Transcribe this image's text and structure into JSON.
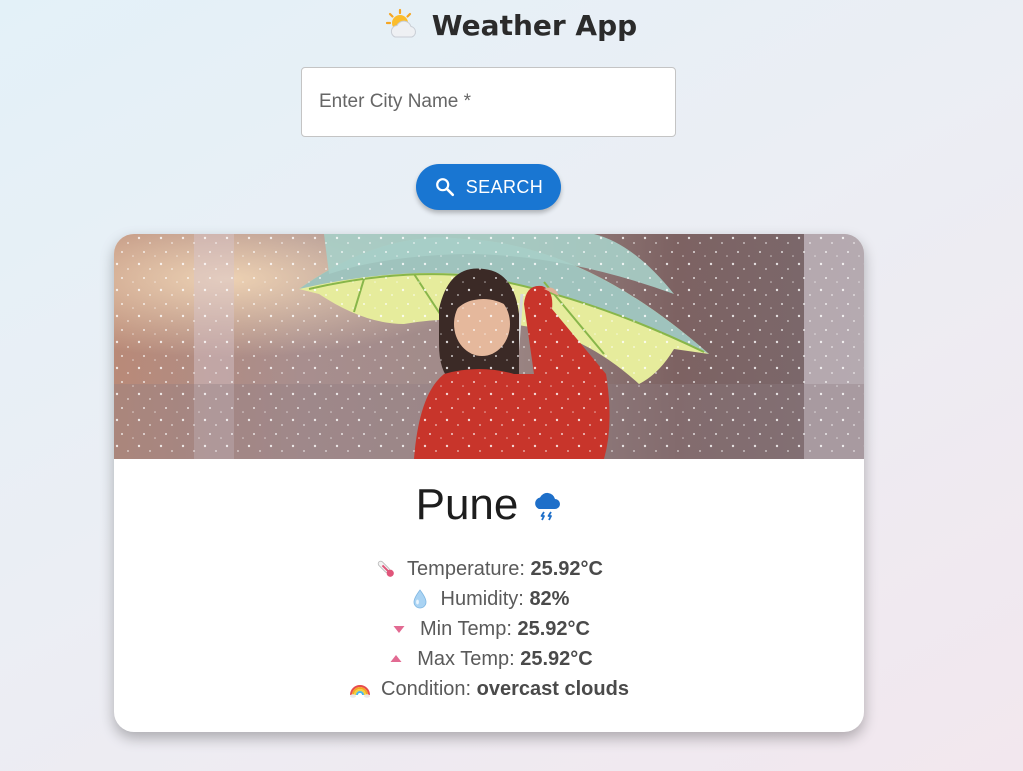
{
  "app": {
    "title": "Weather App",
    "logo_icon": "sun-behind-cloud-icon"
  },
  "search": {
    "placeholder": "Enter City Name *",
    "value": "",
    "button_label": "SEARCH",
    "button_icon": "search-icon"
  },
  "colors": {
    "primary": "#1976d2",
    "card_bg": "#ffffff"
  },
  "weather": {
    "city": "Pune",
    "condition_icon": "rain-cloud-icon",
    "image": "girl-with-umbrella-in-rain",
    "rows": [
      {
        "icon": "thermometer-icon",
        "label": "Temperature:",
        "value": "25.92°C"
      },
      {
        "icon": "droplet-icon",
        "label": "Humidity:",
        "value": "82%"
      },
      {
        "icon": "down-triangle-icon",
        "label": "Min Temp:",
        "value": "25.92°C"
      },
      {
        "icon": "up-triangle-icon",
        "label": "Max Temp:",
        "value": "25.92°C"
      },
      {
        "icon": "rainbow-icon",
        "label": "Condition:",
        "value": "overcast clouds"
      }
    ]
  }
}
